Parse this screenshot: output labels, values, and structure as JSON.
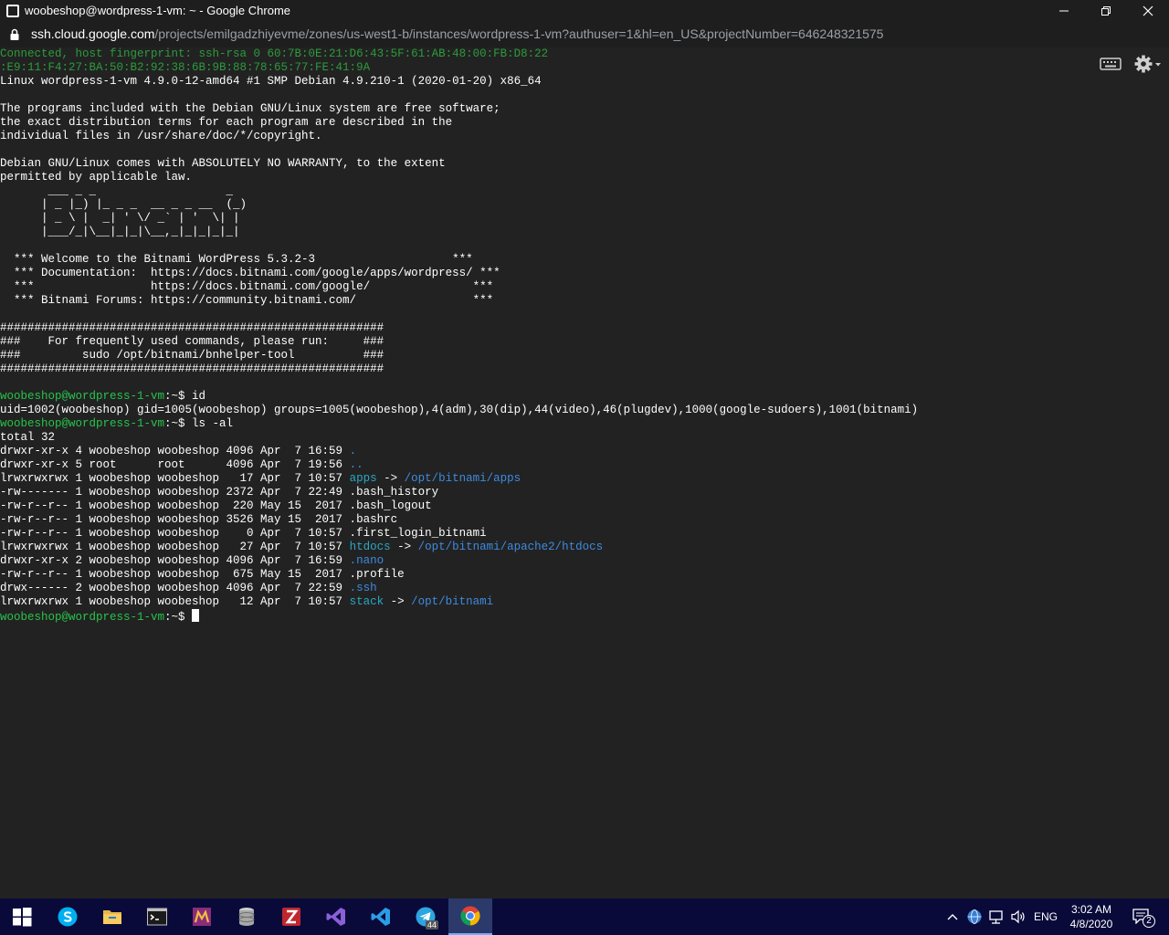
{
  "window": {
    "title": "woobeshop@wordpress-1-vm: ~ - Google Chrome",
    "url_host": "ssh.cloud.google.com",
    "url_path": "/projects/emilgadzhiyevme/zones/us-west1-b/instances/wordpress-1-vm?authuser=1&hl=en_US&projectNumber=646248321575"
  },
  "terminal": {
    "lines": [
      [
        {
          "t": "Connected, host fingerprint: ssh-rsa 0 60:7B:0E:21:D6:43:5F:61:AB:48:00:FB:D8:22",
          "c": "dim-green"
        }
      ],
      [
        {
          "t": ":E9:11:F4:27:BA:50:B2:92:38:6B:9B:88:78:65:77:FE:41:9A",
          "c": "dim-green"
        }
      ],
      [
        {
          "t": "Linux wordpress-1-vm 4.9.0-12-amd64 #1 SMP Debian 4.9.210-1 (2020-01-20) x86_64"
        }
      ],
      [
        {
          "t": ""
        }
      ],
      [
        {
          "t": "The programs included with the Debian GNU/Linux system are free software;"
        }
      ],
      [
        {
          "t": "the exact distribution terms for each program are described in the"
        }
      ],
      [
        {
          "t": "individual files in /usr/share/doc/*/copyright."
        }
      ],
      [
        {
          "t": ""
        }
      ],
      [
        {
          "t": "Debian GNU/Linux comes with ABSOLUTELY NO WARRANTY, to the extent"
        }
      ],
      [
        {
          "t": "permitted by applicable law."
        }
      ],
      [
        {
          "t": "       ___ _ _                   _"
        }
      ],
      [
        {
          "t": "      | _ |_) |_ _ _  __ _ _ __  (_)"
        }
      ],
      [
        {
          "t": "      | _ \\ |  _| ' \\/ _` | '  \\| |"
        }
      ],
      [
        {
          "t": "      |___/_|\\__|_|_|\\__,_|_|_|_|_|"
        }
      ],
      [
        {
          "t": ""
        }
      ],
      [
        {
          "t": "  *** Welcome to the Bitnami WordPress 5.3.2-3                    ***"
        }
      ],
      [
        {
          "t": "  *** Documentation:  https://docs.bitnami.com/google/apps/wordpress/ ***"
        }
      ],
      [
        {
          "t": "  ***                 https://docs.bitnami.com/google/               ***"
        }
      ],
      [
        {
          "t": "  *** Bitnami Forums: https://community.bitnami.com/                 ***"
        }
      ],
      [
        {
          "t": ""
        }
      ],
      [
        {
          "t": "########################################################"
        }
      ],
      [
        {
          "t": "###    For frequently used commands, please run:     ###"
        }
      ],
      [
        {
          "t": "###         sudo /opt/bitnami/bnhelper-tool          ###"
        }
      ],
      [
        {
          "t": "########################################################"
        }
      ],
      [
        {
          "t": ""
        }
      ],
      [
        {
          "t": "woobeshop@wordpress-1-vm",
          "c": "green"
        },
        {
          "t": ":~$ id"
        }
      ],
      [
        {
          "t": "uid=1002(woobeshop) gid=1005(woobeshop) groups=1005(woobeshop),4(adm),30(dip),44(video),46(plugdev),1000(google-sudoers),1001(bitnami)"
        }
      ],
      [
        {
          "t": "woobeshop@wordpress-1-vm",
          "c": "green"
        },
        {
          "t": ":~$ ls -al"
        }
      ],
      [
        {
          "t": "total 32"
        }
      ],
      [
        {
          "t": "drwxr-xr-x 4 woobeshop woobeshop 4096 Apr  7 16:59 "
        },
        {
          "t": ".",
          "c": "blue"
        }
      ],
      [
        {
          "t": "drwxr-xr-x 5 root      root      4096 Apr  7 19:56 "
        },
        {
          "t": "..",
          "c": "blue"
        }
      ],
      [
        {
          "t": "lrwxrwxrwx 1 woobeshop woobeshop   17 Apr  7 10:57 "
        },
        {
          "t": "apps",
          "c": "cyan"
        },
        {
          "t": " -> "
        },
        {
          "t": "/opt/bitnami/apps",
          "c": "blue"
        }
      ],
      [
        {
          "t": "-rw------- 1 woobeshop woobeshop 2372 Apr  7 22:49 .bash_history"
        }
      ],
      [
        {
          "t": "-rw-r--r-- 1 woobeshop woobeshop  220 May 15  2017 .bash_logout"
        }
      ],
      [
        {
          "t": "-rw-r--r-- 1 woobeshop woobeshop 3526 May 15  2017 .bashrc"
        }
      ],
      [
        {
          "t": "-rw-r--r-- 1 woobeshop woobeshop    0 Apr  7 10:57 .first_login_bitnami"
        }
      ],
      [
        {
          "t": "lrwxrwxrwx 1 woobeshop woobeshop   27 Apr  7 10:57 "
        },
        {
          "t": "htdocs",
          "c": "cyan"
        },
        {
          "t": " -> "
        },
        {
          "t": "/opt/bitnami/apache2/htdocs",
          "c": "blue"
        }
      ],
      [
        {
          "t": "drwxr-xr-x 2 woobeshop woobeshop 4096 Apr  7 16:59 "
        },
        {
          "t": ".nano",
          "c": "blue"
        }
      ],
      [
        {
          "t": "-rw-r--r-- 1 woobeshop woobeshop  675 May 15  2017 .profile"
        }
      ],
      [
        {
          "t": "drwx------ 2 woobeshop woobeshop 4096 Apr  7 22:59 "
        },
        {
          "t": ".ssh",
          "c": "blue"
        }
      ],
      [
        {
          "t": "lrwxrwxrwx 1 woobeshop woobeshop   12 Apr  7 10:57 "
        },
        {
          "t": "stack",
          "c": "cyan"
        },
        {
          "t": " -> "
        },
        {
          "t": "/opt/bitnami",
          "c": "blue"
        }
      ],
      [
        {
          "t": "woobeshop@wordpress-1-vm",
          "c": "green"
        },
        {
          "t": ":~$ "
        },
        {
          "cursor": true
        }
      ]
    ]
  },
  "icons": {
    "terminal_toolbar": [
      "keyboard-icon",
      "gear-icon"
    ],
    "taskbar": [
      "windows-start-icon",
      "skype-icon",
      "file-explorer-icon",
      "terminal-icon",
      "metatrader-icon",
      "database-icon",
      "filezilla-icon",
      "visual-studio-icon",
      "vscode-icon",
      "telegram-icon",
      "chrome-icon"
    ],
    "tray": [
      "chevron-up-icon",
      "network-globe-icon",
      "network-icon",
      "volume-icon",
      "notification-icon"
    ]
  },
  "taskbar": {
    "telegram_badge": "44",
    "language": "ENG",
    "time": "3:02 AM",
    "date": "4/8/2020",
    "notification_count": "2"
  },
  "colors": {
    "terminal_bg": "#222222",
    "prompt_green": "#26c44a",
    "link_cyan": "#29a8c4",
    "dir_blue": "#3e8be0",
    "taskbar_bg": "#0a0a3a"
  }
}
